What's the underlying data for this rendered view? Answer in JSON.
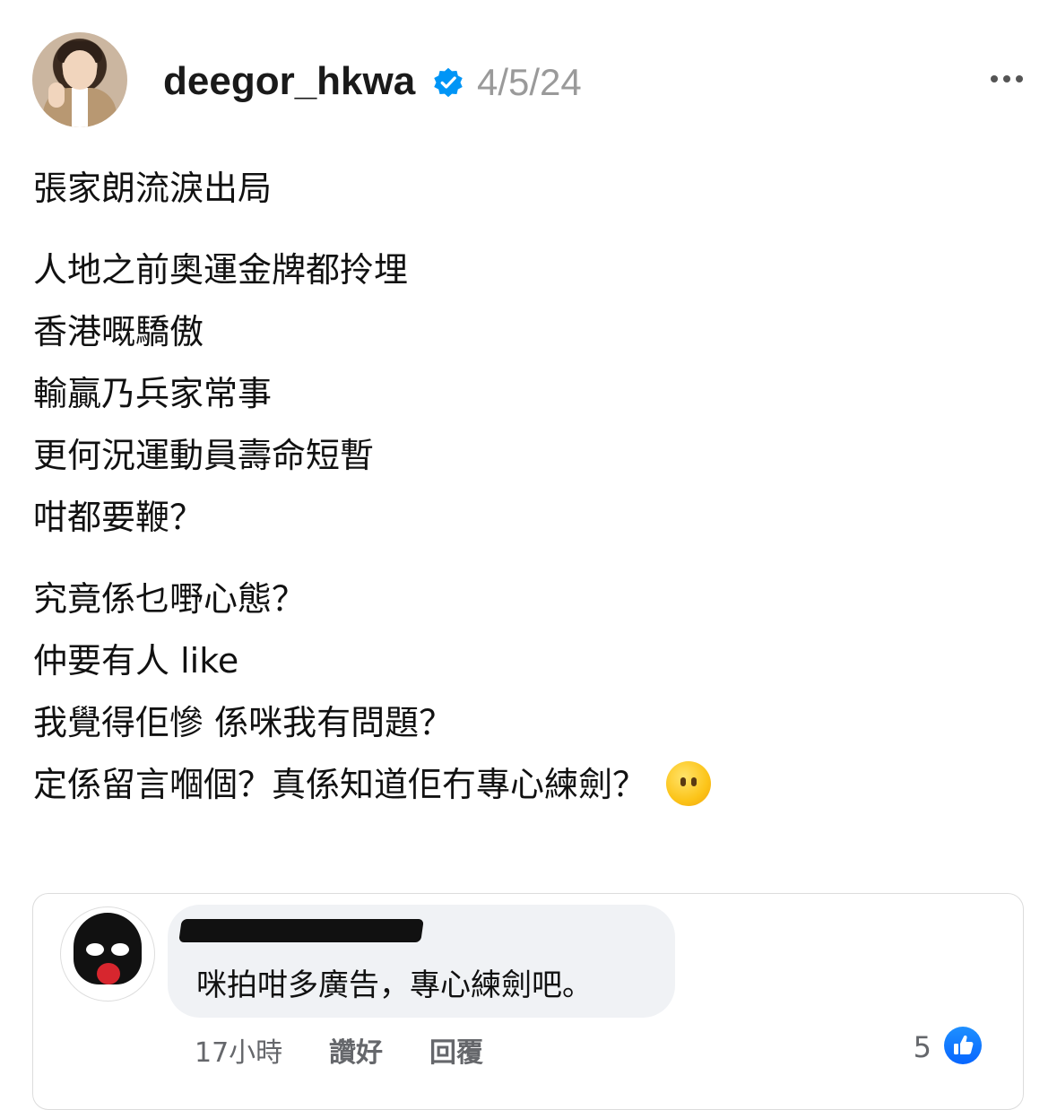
{
  "post": {
    "username": "deegor_hkwa",
    "date": "4/5/24",
    "paragraphs": [
      [
        "張家朗流淚出局"
      ],
      [
        "人地之前奧運金牌都拎埋",
        "香港嘅驕傲",
        "輸贏乃兵家常事",
        "更何況運動員壽命短暫",
        "咁都要鞭？"
      ],
      [
        "究竟係乜嘢心態？",
        "仲要有人 like",
        "我覺得佢慘 係咪我有問題？",
        "定係留言嗰個？真係知道佢冇專心練劍？"
      ]
    ]
  },
  "comment": {
    "text": "咪拍咁多廣告，專心練劍吧。",
    "time": "17小時",
    "like_label": "讚好",
    "reply_label": "回覆",
    "reaction_count": "5"
  },
  "icons": {
    "verified": "verified-badge-icon",
    "more": "more-options-icon",
    "emoji": "no-mouth-face-emoji",
    "like": "thumbs-up-like-icon"
  },
  "colors": {
    "verified": "#0095f6",
    "like": "#0866ff",
    "muted": "#9a9a9a"
  }
}
